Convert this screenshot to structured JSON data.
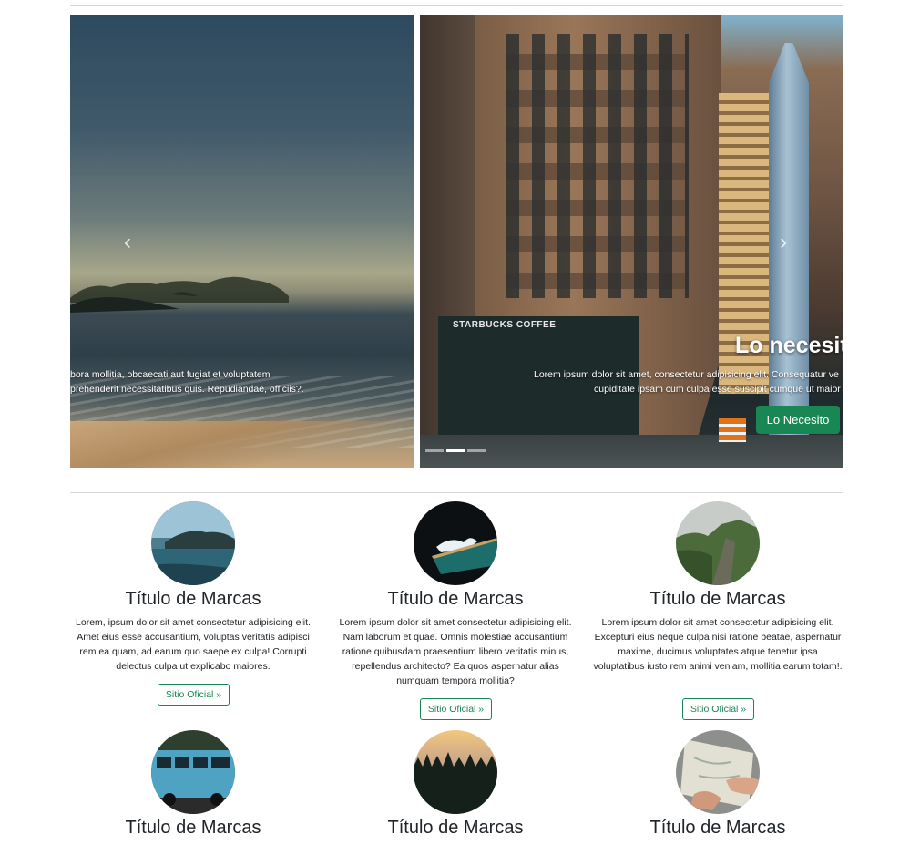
{
  "carousel": {
    "prev_icon": "chevron-left-icon",
    "next_icon": "chevron-right-icon",
    "slide_1": {
      "caption_line1": "bora mollitia, obcaecati aut fugiat et voluptatem",
      "caption_line2": "prehenderit necessitatibus quis. Repudiandae, officiis?."
    },
    "slide_2": {
      "storefront_sign": "STARBUCKS COFFEE",
      "title": "Lo necesito",
      "caption_line1": "Lorem ipsum dolor sit amet, consectetur adipisicing elit. Consequatur ve",
      "caption_line2": "cupiditate ipsam cum culpa esse suscipit cumque ut maior",
      "button_label": "Lo Necesito"
    },
    "indicator_count": 3,
    "active_indicator": 1,
    "accent": "#198754"
  },
  "cards": [
    {
      "title": "Título de Marcas",
      "text": "Lorem, ipsum dolor sit amet consectetur adipisicing elit. Amet eius esse accusantium, voluptas veritatis adipisci rem ea quam, ad earum quo saepe ex culpa! Corrupti delectus culpa ut explicabo maiores.",
      "button": "Sitio Oficial »",
      "image": "lake-mountains"
    },
    {
      "title": "Título de Marcas",
      "text": "Lorem ipsum dolor sit amet consectetur adipisicing elit. Nam laborum et quae. Omnis molestiae accusantium ratione quibusdam praesentium libero veritatis minus, repellendus architecto? Ea quos aspernatur alias numquam tempora mollitia?",
      "button": "Sitio Oficial »",
      "image": "pool-night"
    },
    {
      "title": "Título de Marcas",
      "text": "Lorem ipsum dolor sit amet consectetur adipisicing elit. Excepturi eius neque culpa nisi ratione beatae, aspernatur maxime, ducimus voluptates atque tenetur ipsa voluptatibus iusto rem animi veniam, mollitia earum totam!.",
      "button": "Sitio Oficial »",
      "image": "green-cliffs"
    },
    {
      "title": "Título de Marcas",
      "image": "blue-van"
    },
    {
      "title": "Título de Marcas",
      "image": "forest-sunset"
    },
    {
      "title": "Título de Marcas",
      "image": "map-hands"
    }
  ]
}
